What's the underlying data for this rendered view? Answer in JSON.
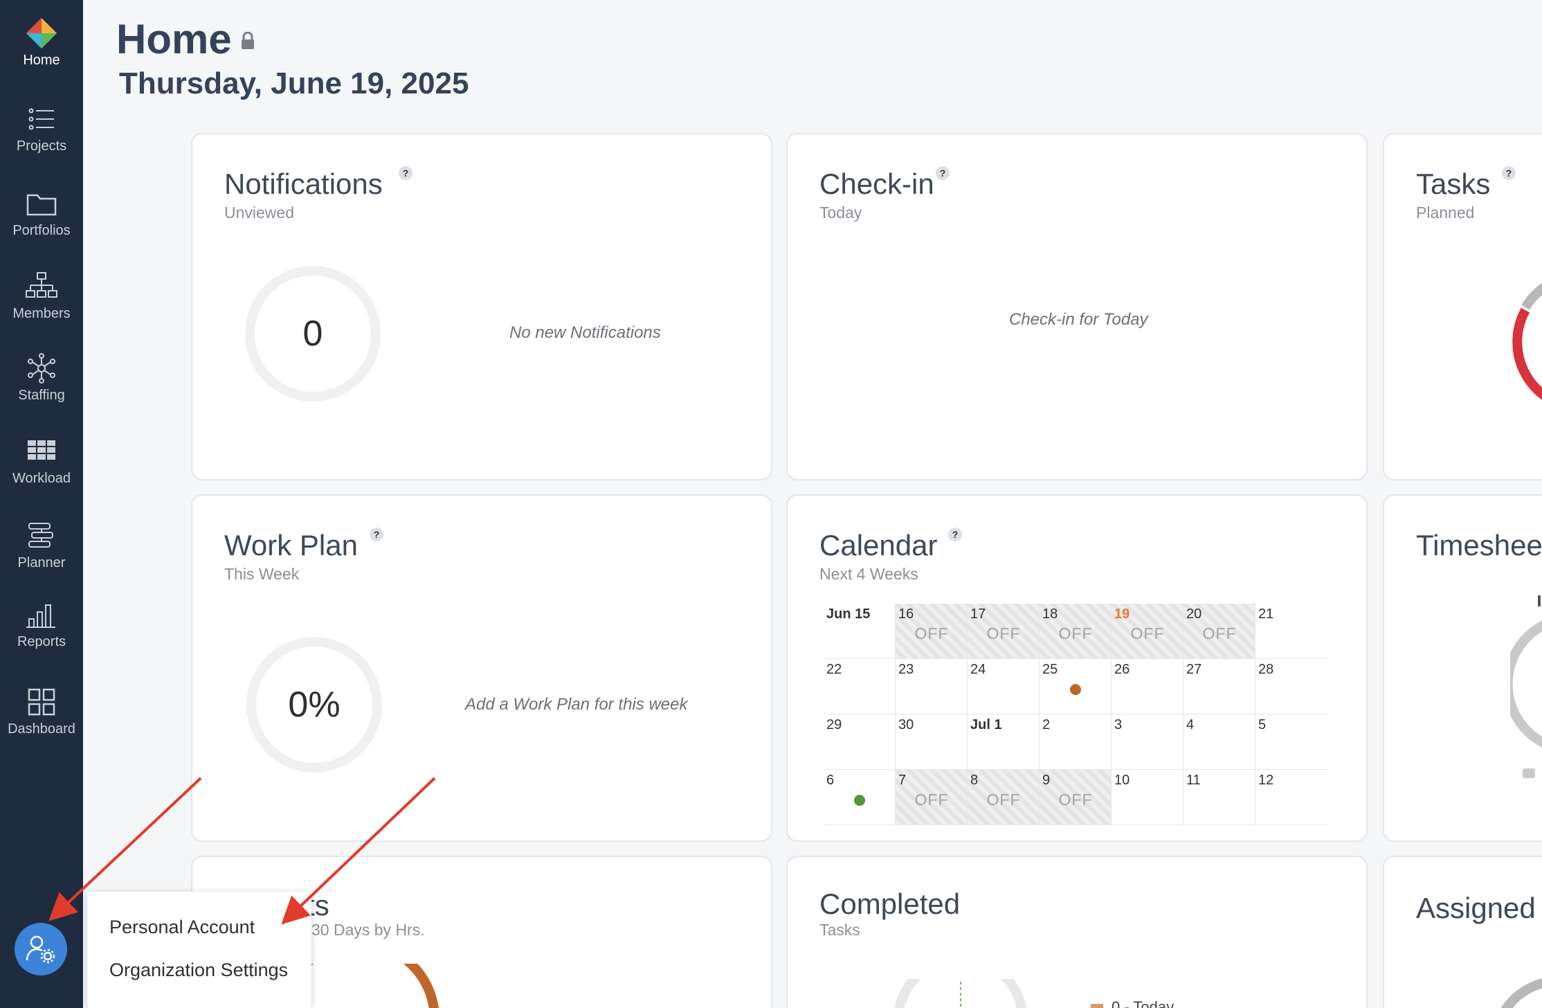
{
  "sidebar": {
    "items": [
      {
        "label": "Home",
        "icon": "logo-icon"
      },
      {
        "label": "Projects",
        "icon": "list-icon"
      },
      {
        "label": "Portfolios",
        "icon": "folder-icon"
      },
      {
        "label": "Members",
        "icon": "org-chart-icon"
      },
      {
        "label": "Staffing",
        "icon": "network-icon"
      },
      {
        "label": "Workload",
        "icon": "grid-icon"
      },
      {
        "label": "Planner",
        "icon": "planner-icon"
      },
      {
        "label": "Reports",
        "icon": "bar-chart-icon"
      },
      {
        "label": "Dashboard",
        "icon": "dashboard-icon"
      }
    ],
    "settings_icon": "user-settings-icon"
  },
  "header": {
    "title": "Home",
    "date": "Thursday, June 19, 2025"
  },
  "help_mark": "?",
  "cards": {
    "notifications": {
      "title": "Notifications",
      "subtitle": "Unviewed",
      "value": "0",
      "message": "No new Notifications"
    },
    "checkin": {
      "title": "Check-in",
      "subtitle": "Today",
      "message": "Check-in for Today"
    },
    "tasks": {
      "title": "Tasks",
      "subtitle": "Planned"
    },
    "workplan": {
      "title": "Work Plan",
      "subtitle": "This Week",
      "value": "0%",
      "message": "Add a Work Plan for this week"
    },
    "calendar": {
      "title": "Calendar",
      "subtitle": "Next 4 Weeks"
    },
    "timesheet": {
      "title": "Timeshee"
    },
    "projects": {
      "title": "ts",
      "subtitle": "30 Days by Hrs."
    },
    "completed": {
      "title": "Completed",
      "subtitle": "Tasks",
      "legend_label": "0 - Today"
    },
    "assigned": {
      "title": "Assigned"
    }
  },
  "calendar": {
    "off_label": "OFF",
    "weeks": [
      [
        {
          "d": "Jun 15",
          "bold": true
        },
        {
          "d": "16",
          "off": true
        },
        {
          "d": "17",
          "off": true
        },
        {
          "d": "18",
          "off": true
        },
        {
          "d": "19",
          "off": true,
          "today": true
        },
        {
          "d": "20",
          "off": true
        },
        {
          "d": "21"
        }
      ],
      [
        {
          "d": "22"
        },
        {
          "d": "23"
        },
        {
          "d": "24"
        },
        {
          "d": "25",
          "dot": "#c0662a"
        },
        {
          "d": "26"
        },
        {
          "d": "27"
        },
        {
          "d": "28"
        }
      ],
      [
        {
          "d": "29"
        },
        {
          "d": "30"
        },
        {
          "d": "Jul 1",
          "bold": true
        },
        {
          "d": "2"
        },
        {
          "d": "3"
        },
        {
          "d": "4"
        },
        {
          "d": "5"
        }
      ],
      [
        {
          "d": "6",
          "dot": "#4e9a3a"
        },
        {
          "d": "7",
          "off": true
        },
        {
          "d": "8",
          "off": true
        },
        {
          "d": "9",
          "off": true
        },
        {
          "d": "10"
        },
        {
          "d": "11"
        },
        {
          "d": "12"
        }
      ]
    ]
  },
  "popup": {
    "items": [
      "Personal Account",
      "Organization Settings"
    ]
  },
  "colors": {
    "sidebar_bg": "#1f2b3e",
    "accent": "#3b82d8",
    "today": "#e8792d",
    "arrow": "#e03b2b",
    "tasks_ring_red": "#d8323a"
  }
}
